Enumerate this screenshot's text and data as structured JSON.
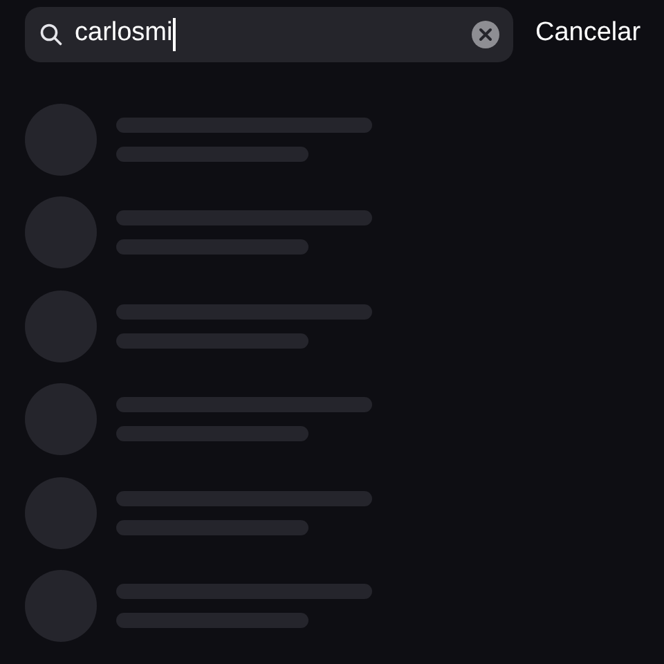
{
  "search": {
    "value": "carlosmi",
    "focused": true
  },
  "cancel_button": "Cancelar",
  "results": [
    {
      "kind": "skeleton"
    },
    {
      "kind": "skeleton"
    },
    {
      "kind": "skeleton"
    },
    {
      "kind": "skeleton"
    },
    {
      "kind": "skeleton"
    },
    {
      "kind": "skeleton"
    }
  ]
}
